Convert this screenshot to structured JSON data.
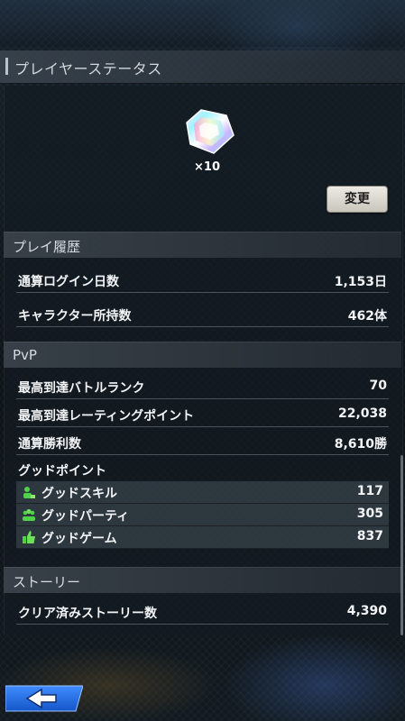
{
  "header": {
    "title": "プレイヤーステータス"
  },
  "reward": {
    "icon": "rainbow-gem-icon",
    "count": "×10"
  },
  "change_button": {
    "label": "変更"
  },
  "play_history": {
    "title": "プレイ履歴",
    "rows": [
      {
        "label": "通算ログイン日数",
        "value": "1,153日"
      },
      {
        "label": "キャラクター所持数",
        "value": "462体"
      }
    ]
  },
  "pvp": {
    "title": "PvP",
    "rows": [
      {
        "label": "最高到達バトルランク",
        "value": "70"
      },
      {
        "label": "最高到達レーティングポイント",
        "value": "22,038"
      },
      {
        "label": "通算勝利数",
        "value": "8,610勝"
      }
    ],
    "good_points": {
      "label": "グッドポイント",
      "items": [
        {
          "icon": "good-skill-icon",
          "label": "グッドスキル",
          "value": "117"
        },
        {
          "icon": "good-party-icon",
          "label": "グッドパーティ",
          "value": "305"
        },
        {
          "icon": "good-game-icon",
          "label": "グッドゲーム",
          "value": "837"
        }
      ]
    }
  },
  "story": {
    "title": "ストーリー",
    "rows": [
      {
        "label": "クリア済みストーリー数",
        "value": "4,390"
      }
    ]
  },
  "colors": {
    "accent_green": "#4fd14a",
    "button_bg": "#e3e0d7",
    "back_button_blue": "#1f6fe6"
  },
  "nav": {
    "back_icon": "back-arrow-icon"
  }
}
